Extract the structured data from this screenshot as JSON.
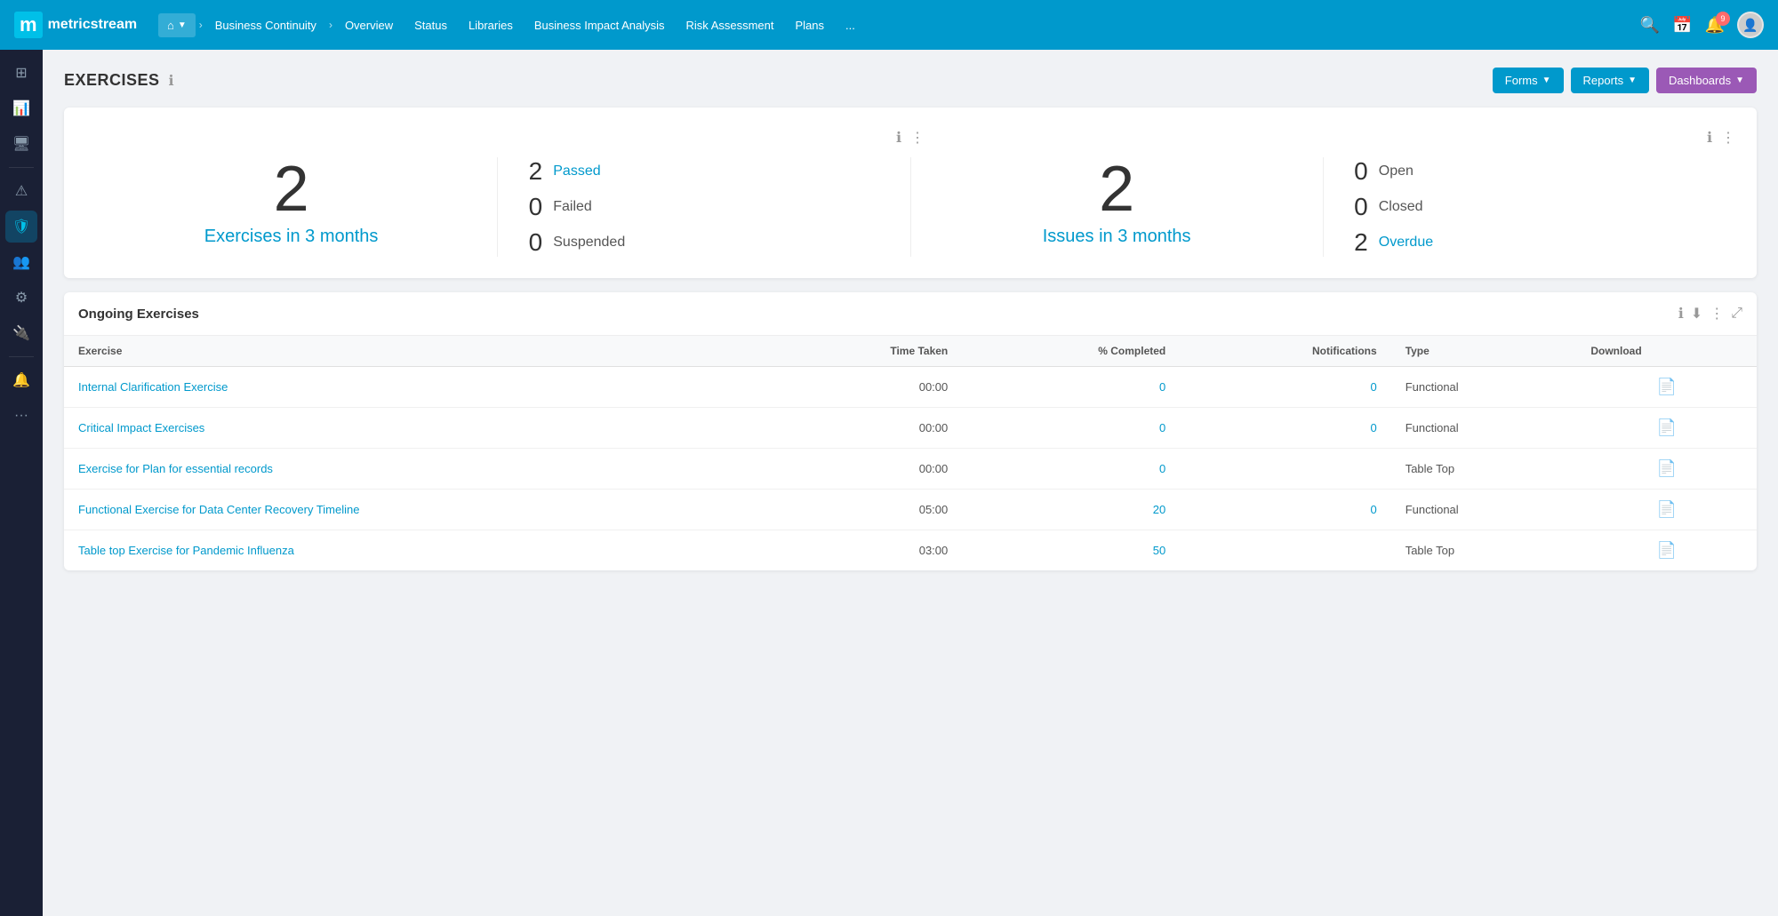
{
  "app": {
    "logo_m": "m",
    "logo_text": "metricstream"
  },
  "nav": {
    "home_icon": "⌂",
    "breadcrumb": [
      {
        "label": "Business Continuity",
        "active": false
      },
      {
        "label": "Overview",
        "active": false
      }
    ],
    "items": [
      {
        "label": "Status"
      },
      {
        "label": "Libraries"
      },
      {
        "label": "Business Impact Analysis"
      },
      {
        "label": "Risk Assessment"
      },
      {
        "label": "Plans"
      },
      {
        "label": "..."
      }
    ],
    "search_icon": "🔍",
    "calendar_icon": "📅",
    "notif_badge": "9",
    "user_icon": "👤"
  },
  "sidebar": {
    "icons": [
      {
        "name": "grid-icon",
        "glyph": "⊞",
        "active": false
      },
      {
        "name": "chart-icon",
        "glyph": "📊",
        "active": false
      },
      {
        "name": "monitor-icon",
        "glyph": "🖥",
        "active": false
      },
      {
        "name": "warning-icon",
        "glyph": "⚠",
        "active": false
      },
      {
        "name": "shield-icon",
        "glyph": "🛡",
        "active": false
      },
      {
        "name": "group-icon",
        "glyph": "👥",
        "active": false
      },
      {
        "name": "settings-icon",
        "glyph": "⚙",
        "active": false
      },
      {
        "name": "plugin-icon",
        "glyph": "🔌",
        "active": false
      },
      {
        "name": "bell-icon",
        "glyph": "🔔",
        "active": false
      },
      {
        "name": "more-icon",
        "glyph": "···",
        "active": false
      }
    ]
  },
  "page": {
    "title": "EXERCISES",
    "info_tooltip": "ℹ"
  },
  "header_buttons": {
    "forms_label": "Forms",
    "reports_label": "Reports",
    "dashboards_label": "Dashboards"
  },
  "stats_left": {
    "big_number": "2",
    "label": "Exercises in 3 months",
    "rows": [
      {
        "num": "2",
        "label": "Passed",
        "class": "passed"
      },
      {
        "num": "0",
        "label": "Failed",
        "class": ""
      },
      {
        "num": "0",
        "label": "Suspended",
        "class": ""
      }
    ]
  },
  "stats_right_widget": {
    "big_number": "2",
    "label": "Issues in 3 months",
    "rows": [
      {
        "num": "0",
        "label": "Open",
        "class": ""
      },
      {
        "num": "0",
        "label": "Closed",
        "class": ""
      },
      {
        "num": "2",
        "label": "Overdue",
        "class": "overdue"
      }
    ]
  },
  "table": {
    "title": "Ongoing Exercises",
    "columns": [
      {
        "label": "Exercise"
      },
      {
        "label": "Time Taken"
      },
      {
        "label": "% Completed"
      },
      {
        "label": "Notifications"
      },
      {
        "label": "Type"
      },
      {
        "label": "Download"
      }
    ],
    "rows": [
      {
        "exercise": "Internal Clarification Exercise",
        "time_taken": "00:00",
        "pct_completed": "0",
        "notifications": "0",
        "type": "Functional",
        "download": "📄"
      },
      {
        "exercise": "Critical Impact Exercises",
        "time_taken": "00:00",
        "pct_completed": "0",
        "notifications": "0",
        "type": "Functional",
        "download": "📄"
      },
      {
        "exercise": "Exercise for Plan for essential records",
        "time_taken": "00:00",
        "pct_completed": "0",
        "notifications": "",
        "type": "Table Top",
        "download": "📄"
      },
      {
        "exercise": "Functional Exercise for Data Center Recovery Timeline",
        "time_taken": "05:00",
        "pct_completed": "20",
        "notifications": "0",
        "type": "Functional",
        "download": "📄"
      },
      {
        "exercise": "Table top Exercise for Pandemic Influenza",
        "time_taken": "03:00",
        "pct_completed": "50",
        "notifications": "",
        "type": "Table Top",
        "download": "📄"
      }
    ]
  }
}
